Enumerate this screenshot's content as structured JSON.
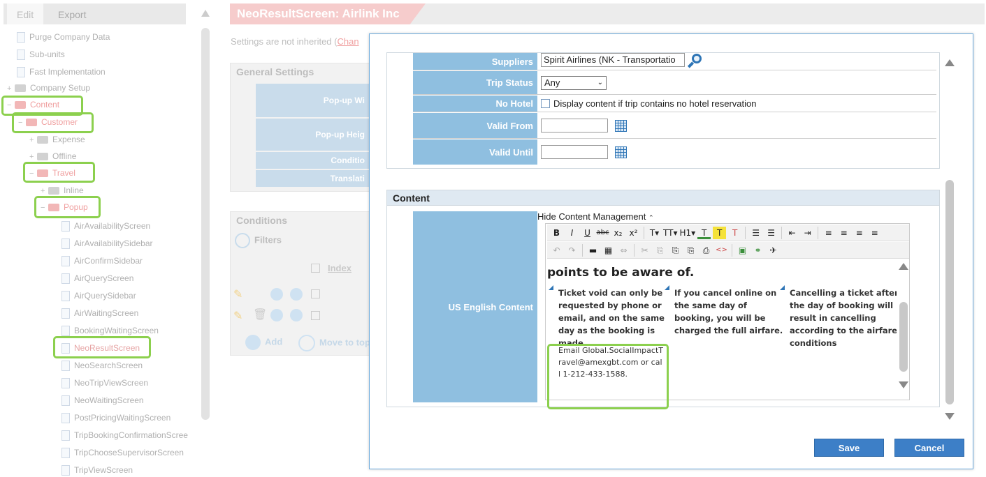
{
  "sidebar": {
    "tabs": [
      "Edit",
      "Export"
    ],
    "tree": [
      {
        "label": "Purge Company Data"
      },
      {
        "label": "Sub-units"
      },
      {
        "label": "Fast Implementation"
      },
      {
        "label": "Company Setup"
      },
      {
        "label": "Content"
      },
      {
        "label": "Customer"
      },
      {
        "label": "Expense"
      },
      {
        "label": "Offline"
      },
      {
        "label": "Travel"
      },
      {
        "label": "Inline"
      },
      {
        "label": "Popup"
      },
      {
        "label": "AirAvailabilityScreen"
      },
      {
        "label": "AirAvailabilitySidebar"
      },
      {
        "label": "AirConfirmSidebar"
      },
      {
        "label": "AirQueryScreen"
      },
      {
        "label": "AirQuerySidebar"
      },
      {
        "label": "AirWaitingScreen"
      },
      {
        "label": "BookingWaitingScreen"
      },
      {
        "label": "NeoResultScreen"
      },
      {
        "label": "NeoSearchScreen"
      },
      {
        "label": "NeoTripViewScreen"
      },
      {
        "label": "NeoWaitingScreen"
      },
      {
        "label": "PostPricingWaitingScreen"
      },
      {
        "label": "TripBookingConfirmationScree"
      },
      {
        "label": "TripChooseSupervisorScreen"
      },
      {
        "label": "TripViewScreen"
      }
    ]
  },
  "page": {
    "title": "NeoResultScreen: Airlink Inc",
    "inherit_note": "Settings are not inherited (",
    "inherit_link": "Chan",
    "general_settings": "General Settings",
    "popup_width": "Pop-up Wi",
    "popup_height": "Pop-up Heig",
    "condition": "Conditio",
    "translation": "Translati",
    "conditions": "Conditions",
    "filters": "Filters",
    "index": "Index",
    "add": "Add",
    "move_to_top": "Move to top"
  },
  "modal": {
    "fields": {
      "suppliers_label": "Suppliers",
      "suppliers_value": "Spirit Airlines (NK - Transportatio",
      "trip_status_label": "Trip Status",
      "trip_status_value": "Any",
      "no_hotel_label": "No Hotel",
      "no_hotel_text": "Display content if trip contains no hotel reservation",
      "valid_from_label": "Valid From",
      "valid_from_value": "",
      "valid_until_label": "Valid Until",
      "valid_until_value": ""
    },
    "content_title": "Content",
    "content_label": "US English Content",
    "hide_content": "Hide Content Management",
    "editor": {
      "toolbar1": [
        "B",
        "I",
        "U",
        "abc",
        "x₂",
        "x²",
        "T▾",
        "TT▾",
        "H1▾",
        "T",
        "T",
        "T",
        "☰",
        "☰",
        "⇤",
        "⇥",
        "≡",
        "≡",
        "≡",
        "≡"
      ],
      "toolbar2": [
        "↶",
        "↷",
        "▬",
        "▦",
        "⇔",
        "✂",
        "⎘",
        "⎘",
        "⎘",
        "⎙",
        "<>",
        "▣",
        "⚭",
        "✈"
      ],
      "heading": "points to be aware of.",
      "bullets": [
        "Ticket void can only be requested by phone or email, and on the same day as the booking is made.",
        "If you cancel online on the same day of booking, you will be charged the full airfare.",
        "Cancelling a ticket after the day of booking will result in cancelling according to the airfare conditions"
      ],
      "email_text": "Email Global.SocialImpactTravel@amexgbt.com or call 1-212-433-1588."
    },
    "save": "Save",
    "cancel": "Cancel"
  },
  "colors": {
    "label_bg": "#8fbfe0",
    "button_bg": "#3d7fc7",
    "highlight": "#8cd04e",
    "title_pink": "#f6cccc"
  }
}
